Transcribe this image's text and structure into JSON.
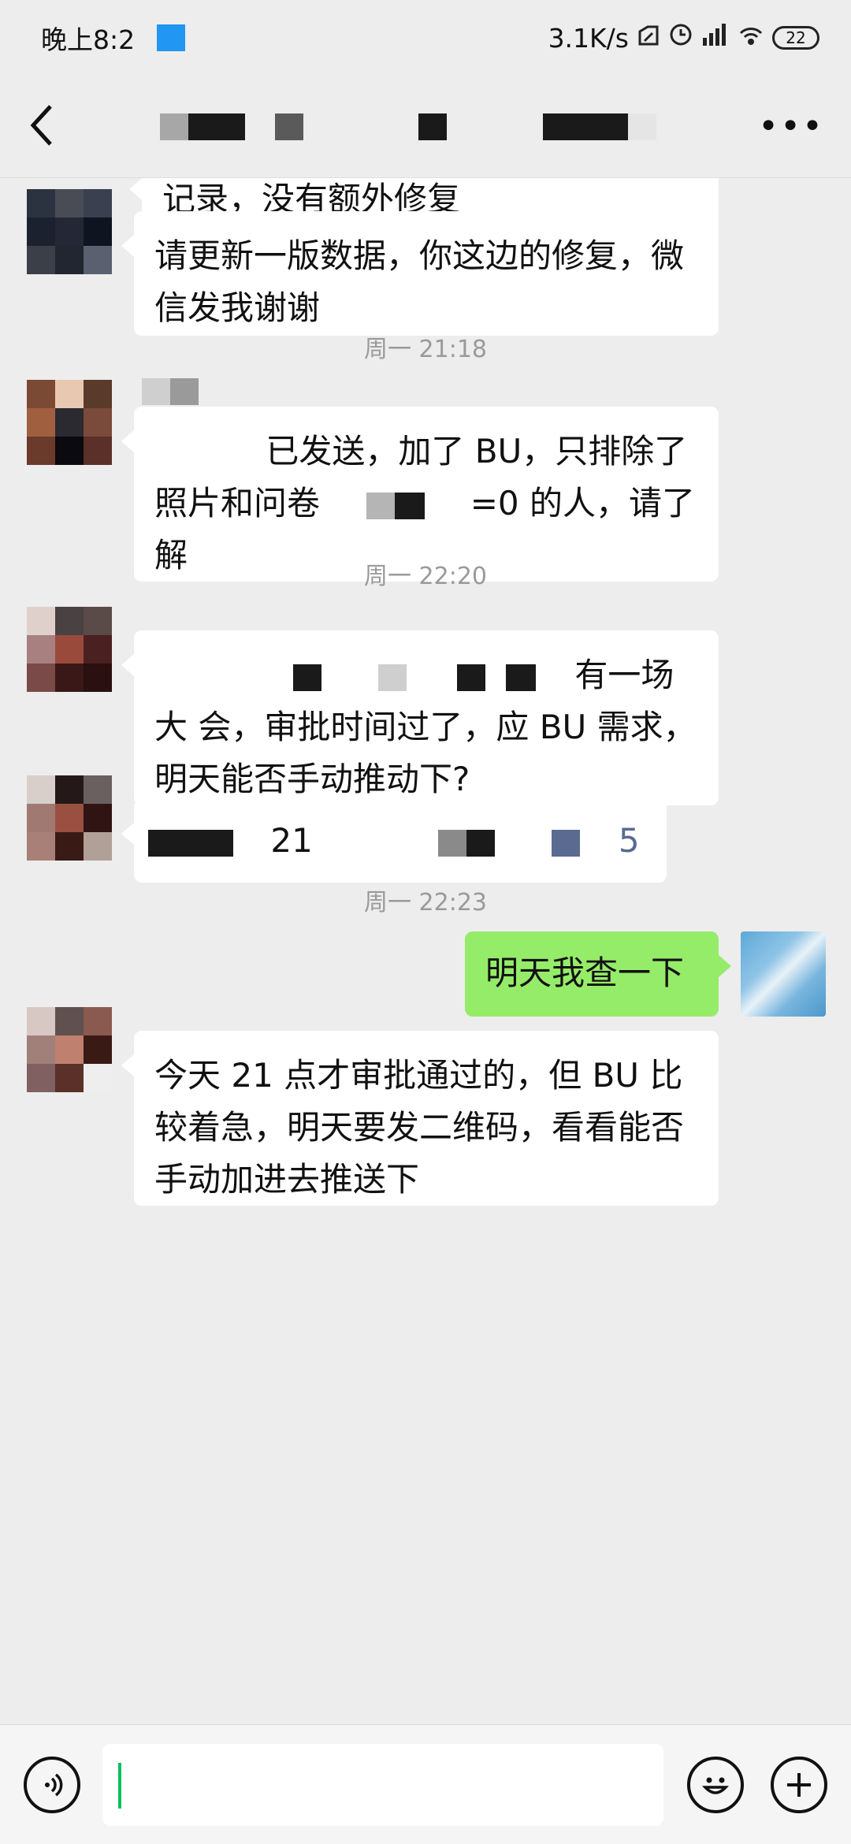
{
  "status_bar": {
    "time": "晚上8:2",
    "net_speed": "3.1K/s",
    "battery": "22"
  },
  "nav": {
    "back_icon": "back-arrow-icon",
    "more_icon": "more-icon"
  },
  "messages": [
    {
      "text": "记录，没有额外修复"
    },
    {
      "text": "请更新一版数据，你这边的修复，微信发我谢谢"
    },
    {
      "time": "周一 21:18"
    },
    {
      "text_part1": "已发送，加了 BU，只排除了 照片和问卷",
      "text_part2": "=0 的人，请了解"
    },
    {
      "time": "周一 22:20"
    },
    {
      "text_part1": "有一场大",
      "text_part2": "会，审批时间过了，应 BU 需求，明天能否手动推动下?"
    },
    {
      "text_part1": "21",
      "text_part2": "5"
    },
    {
      "time": "周一 22:23"
    },
    {
      "text": "明天我查一下"
    },
    {
      "text": "今天 21 点才审批通过的，但 BU 比较着急，明天要发二维码，看看能否手动加进去推送下"
    }
  ],
  "input": {
    "voice_icon": "voice-icon",
    "emoji_icon": "emoji-icon",
    "plus_icon": "plus-icon"
  }
}
